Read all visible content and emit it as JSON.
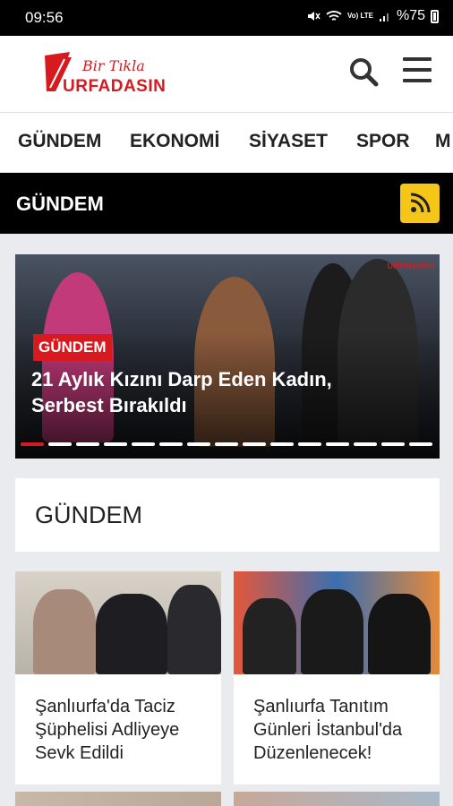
{
  "status": {
    "time": "09:56",
    "battery": "%75",
    "network": "Vo) LTE"
  },
  "header": {
    "logo_script": "Bir Tıkla",
    "logo_main": "URFADASIN"
  },
  "nav": {
    "items": [
      "GÜNDEM",
      "EKONOMİ",
      "SİYASET",
      "SPOR",
      "M"
    ]
  },
  "section": {
    "title": "GÜNDEM"
  },
  "slider": {
    "badge": "GÜNDEM",
    "title": "21 Aylık Kızını Darp Eden Kadın, Serbest Bırakıldı",
    "watermark": "URFADASIN",
    "slide_count": 15,
    "active_index": 0
  },
  "headline": {
    "label": "GÜNDEM"
  },
  "cards": [
    {
      "title": "Şanlıurfa'da Taciz Şüphelisi Adliyeye Sevk Edildi"
    },
    {
      "title": "Şanlıurfa Tanıtım Günleri İstanbul'da Düzenlenecek!"
    }
  ],
  "colors": {
    "brand": "#d71920",
    "rss": "#f5c518",
    "section_bg": "#000000"
  },
  "icons": {
    "search": "search-icon",
    "menu": "hamburger-menu-icon",
    "rss": "rss-icon"
  }
}
